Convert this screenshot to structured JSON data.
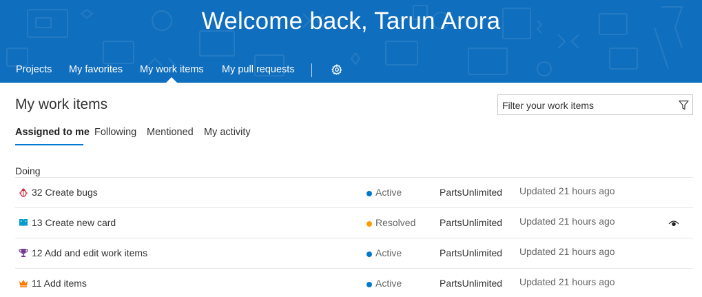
{
  "banner": {
    "title": "Welcome back, Tarun Arora",
    "background": "#106ebe"
  },
  "nav": {
    "items": [
      {
        "label": "Projects"
      },
      {
        "label": "My favorites"
      },
      {
        "label": "My work items",
        "selected": true
      },
      {
        "label": "My pull requests"
      }
    ],
    "settings_icon": "gear-icon"
  },
  "main": {
    "title": "My work items",
    "filter": {
      "placeholder": "Filter your work items",
      "icon": "funnel-icon"
    },
    "tabs": [
      {
        "label": "Assigned to me",
        "selected": true
      },
      {
        "label": "Following"
      },
      {
        "label": "Mentioned"
      },
      {
        "label": "My activity"
      }
    ],
    "accent": "#0078d4",
    "group": {
      "label": "Doing",
      "items": [
        {
          "id_title": "32 Create bugs",
          "type_icon": "bug-icon",
          "type_color": "#cc293d",
          "state": "Active",
          "state_color": "#007acc",
          "project": "PartsUnlimited",
          "updated": "Updated 21 hours ago",
          "following": false
        },
        {
          "id_title": "13 Create new card",
          "type_icon": "book-icon",
          "type_color": "#009ccc",
          "state": "Resolved",
          "state_color": "#ff9d00",
          "project": "PartsUnlimited",
          "updated": "Updated 21 hours ago",
          "following": true,
          "follow_icon": "eye-icon"
        },
        {
          "id_title": "12 Add and edit work items",
          "type_icon": "trophy-icon",
          "type_color": "#773b93",
          "state": "Active",
          "state_color": "#007acc",
          "project": "PartsUnlimited",
          "updated": "Updated 21 hours ago",
          "following": false
        },
        {
          "id_title": "11 Add items",
          "type_icon": "crown-icon",
          "type_color": "#ff7b00",
          "state": "Active",
          "state_color": "#007acc",
          "project": "PartsUnlimited",
          "updated": "Updated 21 hours ago",
          "following": false
        }
      ]
    }
  }
}
